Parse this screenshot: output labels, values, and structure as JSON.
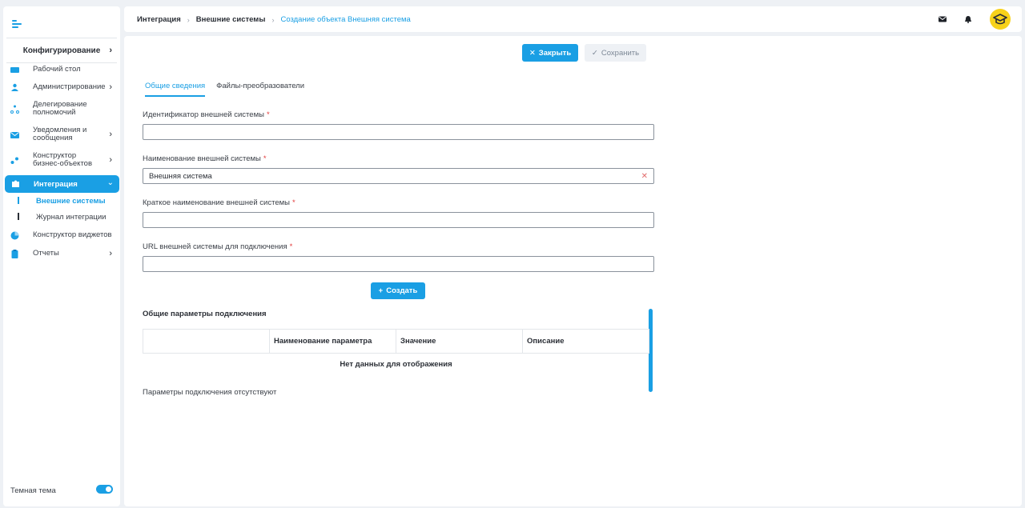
{
  "sidebar": {
    "section": "Конфигурирование",
    "items": [
      {
        "label": "Рабочий стол"
      },
      {
        "label": "Администрирование"
      },
      {
        "label": "Делегирование полномочий"
      },
      {
        "label": "Уведомления и сообщения"
      },
      {
        "label": "Конструктор бизнес-объектов"
      },
      {
        "label": "Интеграция"
      },
      {
        "label": "Конструктор виджетов"
      },
      {
        "label": "Отчеты"
      }
    ],
    "subitems": [
      {
        "label": "Внешние системы"
      },
      {
        "label": "Журнал интеграции"
      }
    ],
    "theme_label": "Темная тема"
  },
  "breadcrumb": {
    "item1": "Интеграция",
    "item2": "Внешние системы",
    "current": "Создание объекта Внешняя система"
  },
  "toolbar": {
    "close_label": "Закрыть",
    "save_label": "Сохранить"
  },
  "tabs": [
    {
      "label": "Общие сведения"
    },
    {
      "label": "Файлы-преобразователи"
    }
  ],
  "form": {
    "id_label": "Идентификатор внешней системы",
    "id_value": "",
    "name_label": "Наименование внешней системы",
    "name_value": "Внешняя система",
    "short_label": "Краткое наименование внешней системы",
    "short_value": "",
    "url_label": "URL внешней системы для подключения",
    "url_value": "",
    "required_mark": "*",
    "create_label": "Создать"
  },
  "params": {
    "title": "Общие параметры подключения",
    "columns": [
      "",
      "Наименование параметра",
      "Значение",
      "Описание"
    ],
    "empty_text": "Нет данных для отображения",
    "none_text": "Параметры подключения отсутствуют"
  },
  "colors": {
    "accent": "#1a9fe4",
    "avatar": "#f7d21a"
  }
}
